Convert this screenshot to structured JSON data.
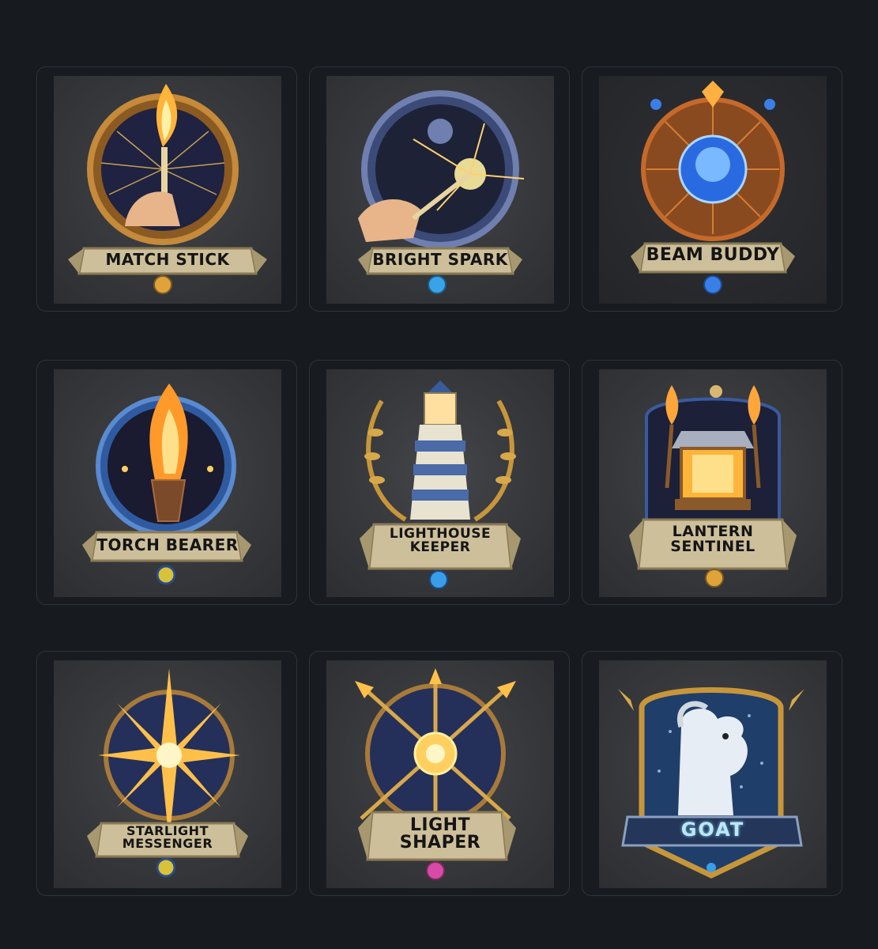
{
  "badges": [
    {
      "title": "MATCH STICK",
      "lines": [
        "MATCH STICK"
      ],
      "motif": "match-flame-icon",
      "gem": "#e0a33a"
    },
    {
      "title": "BRIGHT SPARK",
      "lines": [
        "BRIGHT SPARK"
      ],
      "motif": "spark-wand-icon",
      "gem": "#3aa3e8"
    },
    {
      "title": "BEAM BUDDY",
      "lines": [
        "BEAM BUDDY"
      ],
      "motif": "glowing-orb-icon",
      "gem": "#3a7fe8"
    },
    {
      "title": "TORCH BEARER",
      "lines": [
        "TORCH BEARER"
      ],
      "motif": "torch-flame-icon",
      "gem": "#d8c23a"
    },
    {
      "title": "LIGHTHOUSE KEEPER",
      "lines": [
        "LIGHTHOUSE",
        "KEEPER"
      ],
      "motif": "lighthouse-icon",
      "gem": "#3a9de8"
    },
    {
      "title": "LANTERN SENTINEL",
      "lines": [
        "LANTERN",
        "SENTINEL"
      ],
      "motif": "lantern-icon",
      "gem": "#e0a33a"
    },
    {
      "title": "STARLIGHT MESSENGER",
      "lines": [
        "STARLIGHT",
        "MESSENGER"
      ],
      "motif": "star-burst-icon",
      "gem": "#d8c23a"
    },
    {
      "title": "LIGHT SHAPER",
      "lines": [
        "LIGHT",
        "SHAPER"
      ],
      "motif": "sun-arrows-icon",
      "gem": "#d84aa8"
    },
    {
      "title": "GOAT",
      "lines": [
        "GOAT"
      ],
      "motif": "goat-icon",
      "gem": "#3a9de8"
    }
  ]
}
